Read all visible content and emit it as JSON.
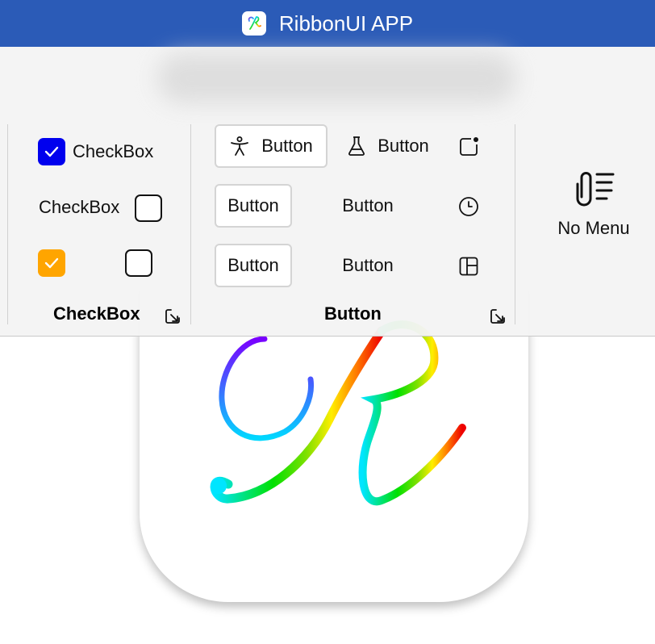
{
  "window": {
    "title": "RibbonUI APP"
  },
  "ribbon": {
    "checkbox_group": {
      "title": "CheckBox",
      "items": [
        {
          "label": "CheckBox",
          "checked": true,
          "color": "#0000ee"
        },
        {
          "label": "CheckBox",
          "checked": false
        },
        {
          "label": "",
          "checked": true,
          "color": "#ffa500"
        },
        {
          "label": "",
          "checked": false
        }
      ]
    },
    "button_group": {
      "title": "Button",
      "rows": [
        [
          {
            "label": "Button",
            "icon": "accessibility-icon",
            "bordered": true
          },
          {
            "label": "Button",
            "icon": "flask-icon",
            "bordered": false
          },
          {
            "label": "",
            "icon": "notification-square-icon"
          }
        ],
        [
          {
            "label": "Button",
            "bordered": true
          },
          {
            "label": "Button",
            "bordered": false
          },
          {
            "label": "",
            "icon": "clock-icon"
          }
        ],
        [
          {
            "label": "Button",
            "bordered": true
          },
          {
            "label": "Button",
            "bordered": false
          },
          {
            "label": "",
            "icon": "layout-icon"
          }
        ]
      ]
    },
    "no_menu": {
      "label": "No Menu",
      "icon": "attach-text-icon"
    }
  },
  "colors": {
    "titlebar": "#2b5bb7",
    "checkbox_blue": "#0000ee",
    "checkbox_orange": "#ffa500"
  }
}
